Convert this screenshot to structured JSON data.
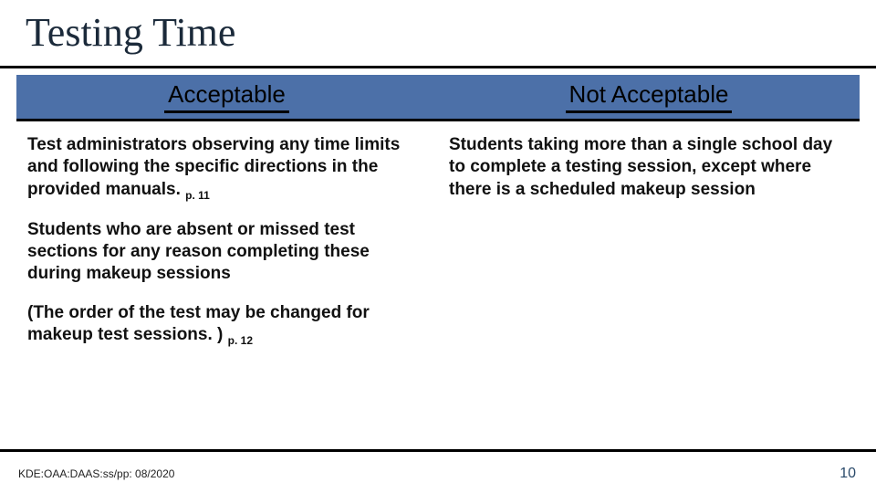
{
  "title": "Testing Time",
  "columns": {
    "left_header": "Acceptable",
    "right_header": "Not  Acceptable"
  },
  "left": {
    "p1_text": "Test administrators observing any time limits and following the specific directions in the provided manuals. ",
    "p1_ref": "p. 11",
    "p2_text": "Students who are absent or missed test sections for any reason completing these during makeup sessions",
    "p3_text": "(The order of the test may be changed for makeup test sessions. ) ",
    "p3_ref": "p. 12"
  },
  "right": {
    "p1_text": "Students taking more than a single school day to complete a testing session, except where there is a scheduled makeup session"
  },
  "footer_left": "KDE:OAA:DAAS:ss/pp: 08/2020",
  "page_number": "10",
  "colors": {
    "header_fill": "#4c70a8",
    "title_color": "#1b2a3a"
  }
}
